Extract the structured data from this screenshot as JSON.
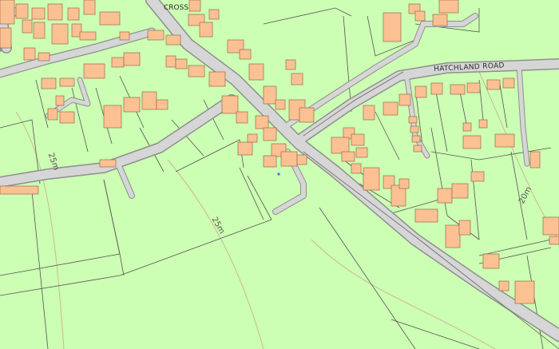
{
  "map": {
    "colors": {
      "land": "#ccfeb3",
      "road": "#d6d6d6",
      "road_edge": "#8f8f8f",
      "building": "#fbc193",
      "building_edge": "#9a6a4a",
      "boundary": "#555555",
      "contour": "#c9a88a"
    },
    "labels": {
      "place": "CROSS",
      "road_name": "HATCHLAND ROAD"
    },
    "contour_labels": [
      "25m",
      "25m",
      "20m"
    ]
  }
}
